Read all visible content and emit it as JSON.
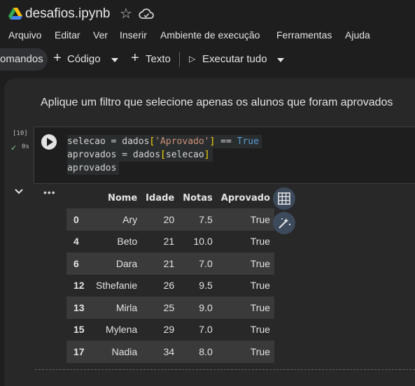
{
  "title_bar": {
    "file_name": "desafios.ipynb"
  },
  "menu": [
    "Arquivo",
    "Editar",
    "Ver",
    "Inserir",
    "Ambiente de execução",
    "Ferramentas",
    "Ajuda"
  ],
  "toolbar": {
    "commands_label": "omandos",
    "code_label": "Código",
    "text_label": "Texto",
    "run_all_label": "Executar tudo"
  },
  "text_cell": "Aplique um filtro que selecione apenas os alunos que foram aprovados",
  "code_cell": {
    "exec_count": "[10]",
    "exec_time": "0s",
    "lines": [
      "selecao = dados['Aprovado'] == True",
      "aprovados = dados[selecao]",
      "aprovados"
    ]
  },
  "output": {
    "menu_glyph": "•••",
    "columns": [
      "",
      "Nome",
      "Idade",
      "Notas",
      "Aprovado"
    ],
    "rows": [
      [
        "0",
        "Ary",
        "20",
        "7.5",
        "True"
      ],
      [
        "4",
        "Beto",
        "21",
        "10.0",
        "True"
      ],
      [
        "6",
        "Dara",
        "21",
        "7.0",
        "True"
      ],
      [
        "12",
        "Sthefanie",
        "26",
        "9.5",
        "True"
      ],
      [
        "13",
        "Mirla",
        "25",
        "9.0",
        "True"
      ],
      [
        "15",
        "Mylena",
        "29",
        "7.0",
        "True"
      ],
      [
        "17",
        "Nadia",
        "34",
        "8.0",
        "True"
      ]
    ]
  },
  "icons": {
    "logo": "google-drive-logo",
    "star": "star-icon",
    "cloud": "cloud-icon",
    "run": "play-icon",
    "collapse": "chevron-down-icon",
    "table": "table-icon",
    "wand": "magic-wand-icon"
  }
}
